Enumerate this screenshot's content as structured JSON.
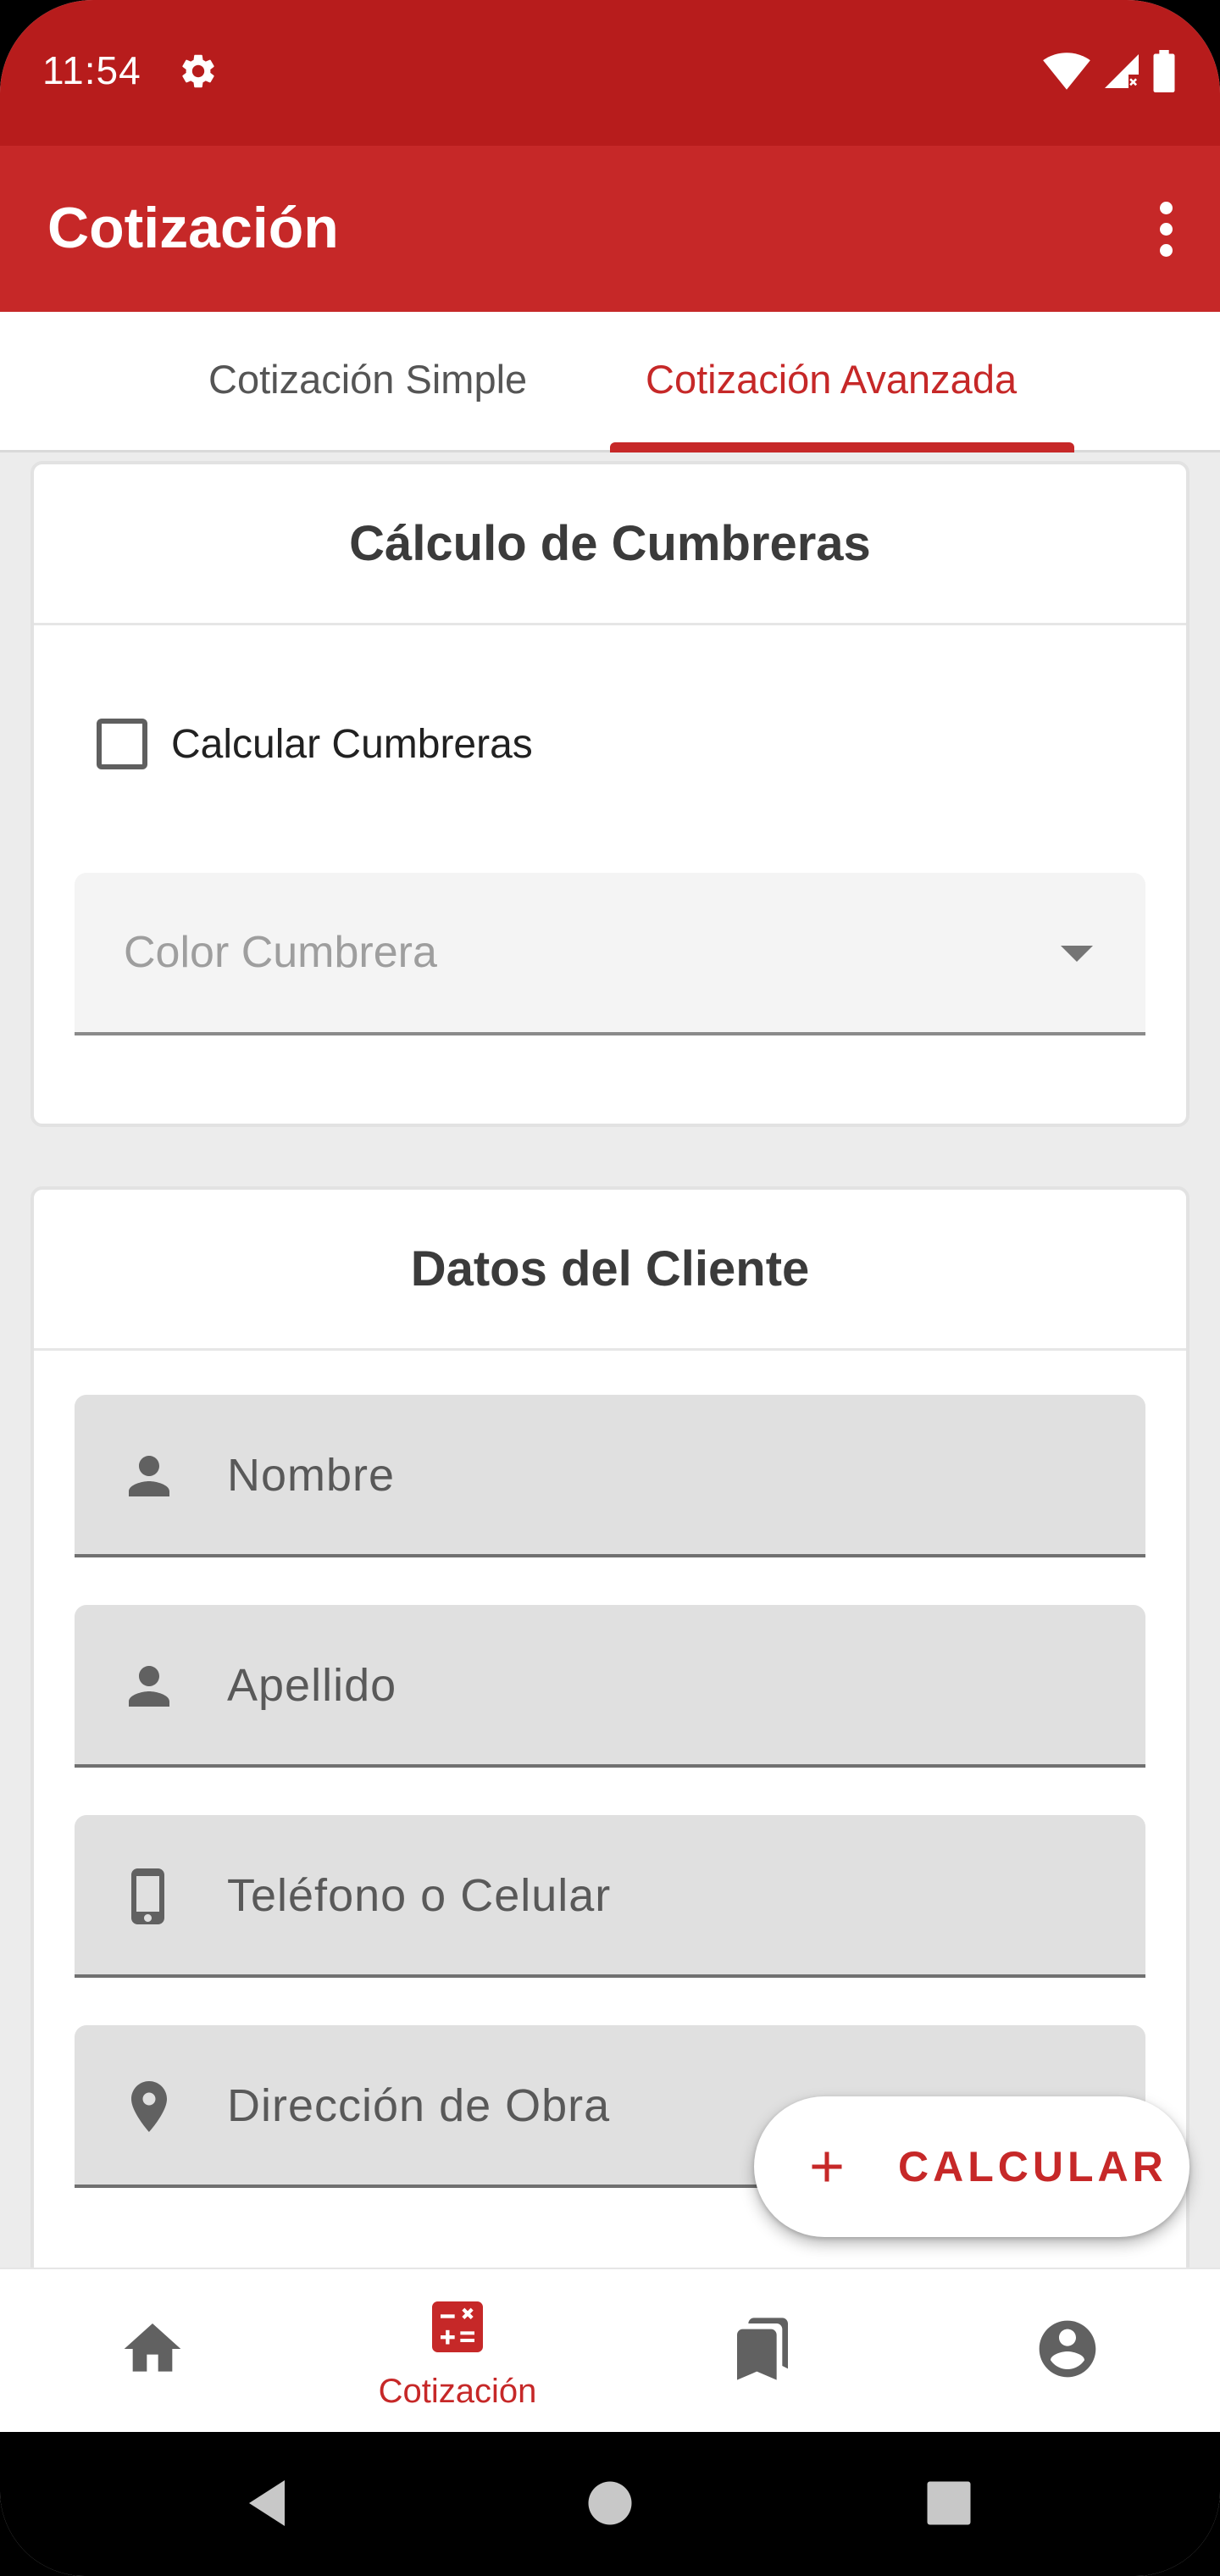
{
  "status_bar": {
    "time": "11:54",
    "icons": [
      "gear-icon",
      "wifi-icon",
      "signal-icon",
      "battery-icon"
    ]
  },
  "app_bar": {
    "title": "Cotización",
    "menu_icon": "overflow-menu-icon"
  },
  "tabs": [
    {
      "label": "Cotización Simple",
      "active": false
    },
    {
      "label": "Cotización Avanzada",
      "active": true
    }
  ],
  "cumbreras_card": {
    "title": "Cálculo de Cumbreras",
    "checkbox_label": "Calcular Cumbreras",
    "checkbox_checked": false,
    "select_placeholder": "Color Cumbrera"
  },
  "cliente_card": {
    "title": "Datos del Cliente",
    "fields": [
      {
        "placeholder": "Nombre",
        "icon": "person-icon"
      },
      {
        "placeholder": "Apellido",
        "icon": "person-icon"
      },
      {
        "placeholder": "Teléfono o Celular",
        "icon": "phone-icon"
      },
      {
        "placeholder": "Dirección de Obra",
        "icon": "location-pin-icon"
      }
    ]
  },
  "fab": {
    "label": "CALCULAR",
    "icon": "plus-icon"
  },
  "bottom_nav": {
    "items": [
      {
        "icon": "home-icon",
        "label": "",
        "active": false
      },
      {
        "icon": "calculator-icon",
        "label": "Cotización",
        "active": true
      },
      {
        "icon": "bookmarks-icon",
        "label": "",
        "active": false
      },
      {
        "icon": "account-icon",
        "label": "",
        "active": false
      }
    ]
  },
  "colors": {
    "primary": "#c62828",
    "primary_dark": "#b71c1c",
    "background": "#ececec"
  }
}
